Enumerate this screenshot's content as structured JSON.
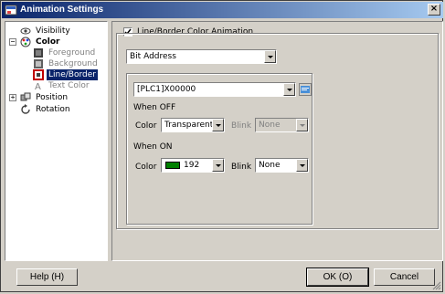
{
  "window": {
    "title": "Animation Settings",
    "close_label": "×"
  },
  "tree": {
    "items": [
      {
        "label": "Visibility",
        "icon": "eye-icon",
        "state": "normal"
      },
      {
        "label": "Color",
        "icon": "palette-icon",
        "state": "bold",
        "expander": "−"
      },
      {
        "label": "Foreground",
        "icon": "foreground-icon",
        "state": "disabled"
      },
      {
        "label": "Background",
        "icon": "background-icon",
        "state": "disabled"
      },
      {
        "label": "Line/Border",
        "icon": "line-border-icon",
        "state": "selected"
      },
      {
        "label": "Text Color",
        "icon": "text-color-icon",
        "state": "disabled"
      },
      {
        "label": "Position",
        "icon": "position-icon",
        "state": "normal",
        "expander": "+"
      },
      {
        "label": "Rotation",
        "icon": "rotation-icon",
        "state": "normal"
      }
    ]
  },
  "panel": {
    "enable_checkbox": {
      "label": "Line/Border Color Animation",
      "checked": true
    },
    "mode_select": {
      "value": "Bit Address"
    },
    "address_select": {
      "value": "[PLC1]X00000"
    },
    "address_browse_icon": "address-book-icon",
    "when_off": {
      "heading": "When OFF",
      "color_label": "Color",
      "color_value": "Transparent",
      "blink_label": "Blink",
      "blink_value": "None"
    },
    "when_on": {
      "heading": "When ON",
      "color_label": "Color",
      "color_value": "192",
      "color_swatch": "#008000",
      "blink_label": "Blink",
      "blink_value": "None"
    }
  },
  "buttons": {
    "help": "Help (H)",
    "ok": "OK (O)",
    "cancel": "Cancel"
  }
}
